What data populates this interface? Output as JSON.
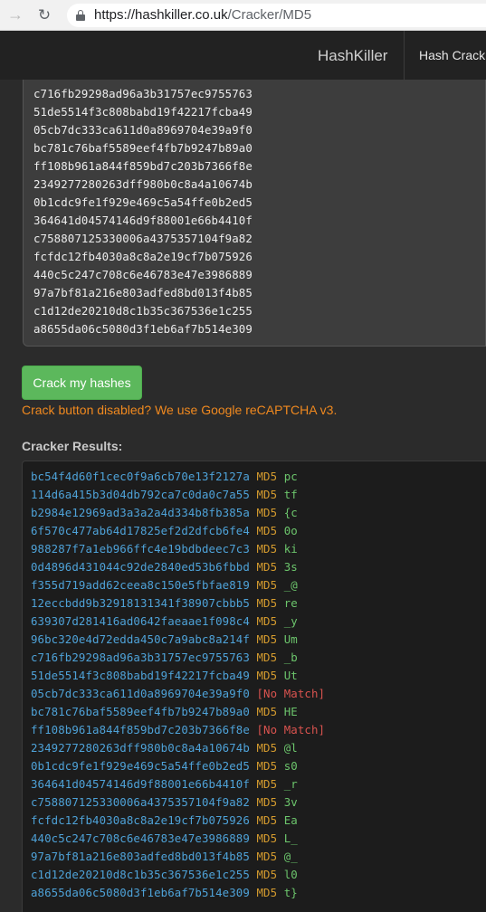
{
  "browser": {
    "url_scheme": "https://",
    "url_host": "hashkiller.co.uk",
    "url_path": "/Cracker/MD5"
  },
  "header": {
    "brand": "HashKiller",
    "nav_link": "Hash Crack"
  },
  "input_hashes_partial_top": "96bc320e4d72edda450c7a9abc8a214f",
  "input_hashes": [
    "c716fb29298ad96a3b31757ec9755763",
    "51de5514f3c808babd19f42217fcba49",
    "05cb7dc333ca611d0a8969704e39a9f0",
    "bc781c76baf5589eef4fb7b9247b89a0",
    "ff108b961a844f859bd7c203b7366f8e",
    "2349277280263dff980b0c8a4a10674b",
    "0b1cdc9fe1f929e469c5a54ffe0b2ed5",
    "364641d04574146d9f88001e66b4410f",
    "c758807125330006a4375357104f9a82",
    "fcfdc12fb4030a8c8a2e19cf7b075926",
    "440c5c247c708c6e46783e47e3986889",
    "97a7bf81a216e803adfed8bd013f4b85",
    "c1d12de20210d8c1b35c367536e1c255",
    "a8655da06c5080d3f1eb6af7b514e309"
  ],
  "crack_button": "Crack my hashes",
  "captcha_note": "Crack button disabled? We use Google reCAPTCHA v3.",
  "results_label": "Cracker Results:",
  "results": [
    {
      "hash": "bc54f4d60f1cec0f9a6cb70e13f2127a",
      "type": "MD5",
      "plain": "pc"
    },
    {
      "hash": "114d6a415b3d04db792ca7c0da0c7a55",
      "type": "MD5",
      "plain": "tf"
    },
    {
      "hash": "b2984e12969ad3a3a2a4d334b8fb385a",
      "type": "MD5",
      "plain": "{c"
    },
    {
      "hash": "6f570c477ab64d17825ef2d2dfcb6fe4",
      "type": "MD5",
      "plain": "0o"
    },
    {
      "hash": "988287f7a1eb966ffc4e19bdbdeec7c3",
      "type": "MD5",
      "plain": "ki"
    },
    {
      "hash": "0d4896d431044c92de2840ed53b6fbbd",
      "type": "MD5",
      "plain": "3s"
    },
    {
      "hash": "f355d719add62ceea8c150e5fbfae819",
      "type": "MD5",
      "plain": "_@"
    },
    {
      "hash": "12eccbdd9b32918131341f38907cbbb5",
      "type": "MD5",
      "plain": "re"
    },
    {
      "hash": "639307d281416ad0642faeaae1f098c4",
      "type": "MD5",
      "plain": "_y"
    },
    {
      "hash": "96bc320e4d72edda450c7a9abc8a214f",
      "type": "MD5",
      "plain": "Um"
    },
    {
      "hash": "c716fb29298ad96a3b31757ec9755763",
      "type": "MD5",
      "plain": "_b"
    },
    {
      "hash": "51de5514f3c808babd19f42217fcba49",
      "type": "MD5",
      "plain": "Ut"
    },
    {
      "hash": "05cb7dc333ca611d0a8969704e39a9f0",
      "type": "",
      "plain": "[No Match]"
    },
    {
      "hash": "bc781c76baf5589eef4fb7b9247b89a0",
      "type": "MD5",
      "plain": "HE"
    },
    {
      "hash": "ff108b961a844f859bd7c203b7366f8e",
      "type": "",
      "plain": "[No Match]"
    },
    {
      "hash": "2349277280263dff980b0c8a4a10674b",
      "type": "MD5",
      "plain": "@l"
    },
    {
      "hash": "0b1cdc9fe1f929e469c5a54ffe0b2ed5",
      "type": "MD5",
      "plain": "s0"
    },
    {
      "hash": "364641d04574146d9f88001e66b4410f",
      "type": "MD5",
      "plain": "_r"
    },
    {
      "hash": "c758807125330006a4375357104f9a82",
      "type": "MD5",
      "plain": "3v"
    },
    {
      "hash": "fcfdc12fb4030a8c8a2e19cf7b075926",
      "type": "MD5",
      "plain": "Ea"
    },
    {
      "hash": "440c5c247c708c6e46783e47e3986889",
      "type": "MD5",
      "plain": "L_"
    },
    {
      "hash": "97a7bf81a216e803adfed8bd013f4b85",
      "type": "MD5",
      "plain": "@_"
    },
    {
      "hash": "c1d12de20210d8c1b35c367536e1c255",
      "type": "MD5",
      "plain": "l0"
    },
    {
      "hash": "a8655da06c5080d3f1eb6af7b514e309",
      "type": "MD5",
      "plain": "t}"
    }
  ],
  "colors": {
    "hash": "#4ea2d8",
    "type": "#d39a2e",
    "no_match": "#d9534f",
    "plain": "#6cc56c",
    "button": "#5cb85c",
    "note": "#f0891f"
  }
}
